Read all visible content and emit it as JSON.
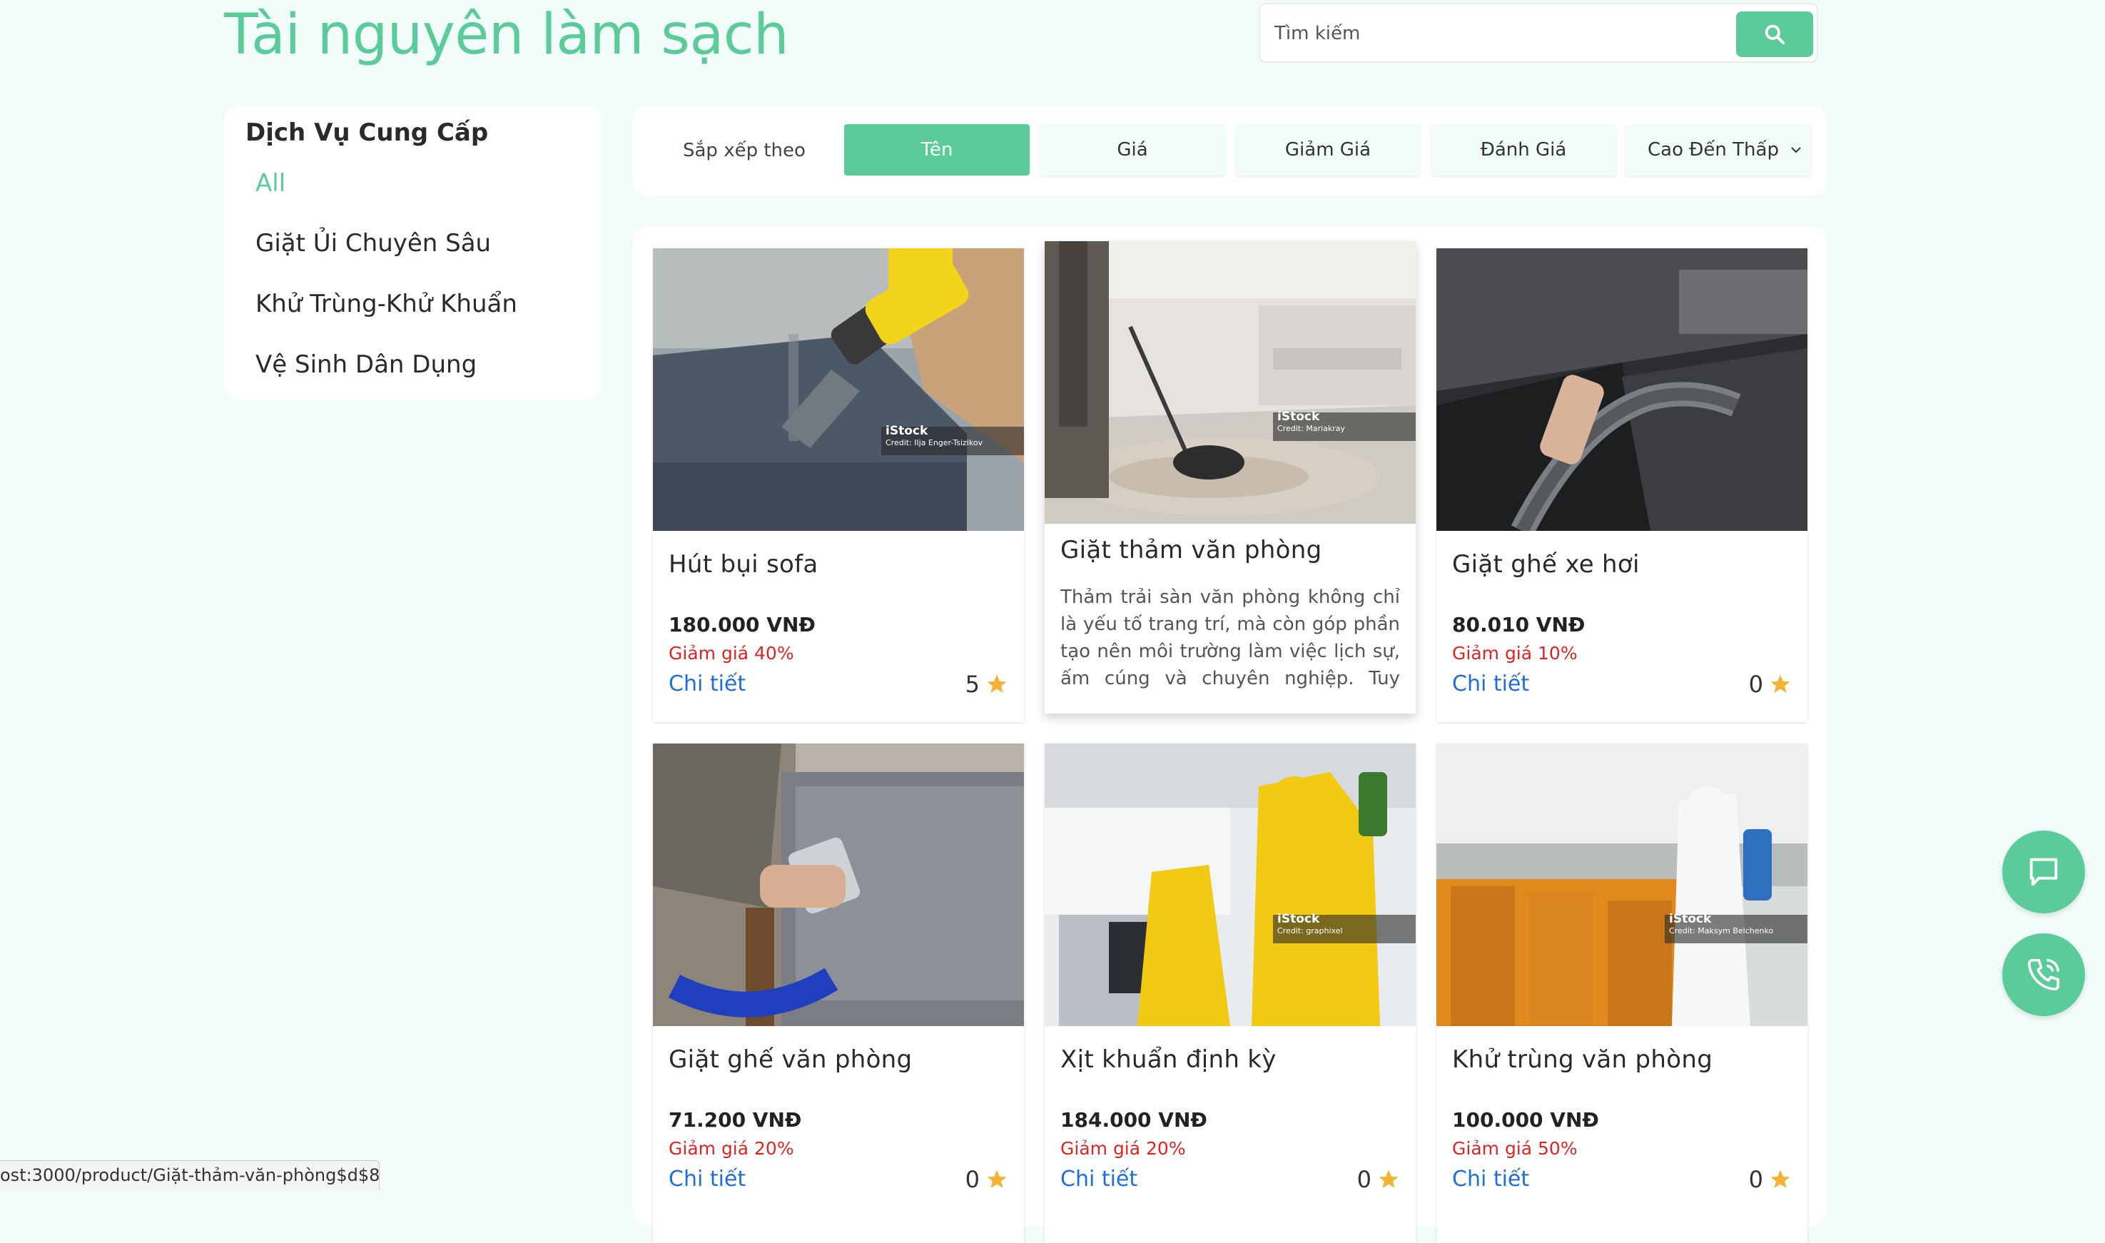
{
  "header": {
    "title": "Tài nguyên làm sạch",
    "search_placeholder": "Tìm kiếm"
  },
  "sidebar": {
    "title": "Dịch Vụ Cung Cấp",
    "items": [
      {
        "label": "All",
        "active": true
      },
      {
        "label": "Giặt Ủi Chuyên Sâu",
        "active": false
      },
      {
        "label": "Khử Trùng-Khử Khuẩn",
        "active": false
      },
      {
        "label": "Vệ Sinh Dân Dụng",
        "active": false
      }
    ]
  },
  "sort": {
    "label": "Sắp xếp theo",
    "buttons": [
      {
        "label": "Tên",
        "active": true
      },
      {
        "label": "Giá",
        "active": false
      },
      {
        "label": "Giảm Giá",
        "active": false
      },
      {
        "label": "Đánh Giá",
        "active": false
      }
    ],
    "order_selected": "Cao Đến Thấp"
  },
  "products": [
    {
      "name": "Hút bụi sofa",
      "price": "180.000 VNĐ",
      "discount": "Giảm giá 40%",
      "link": "Chi tiết",
      "rating": "5",
      "image_caption": "iStock",
      "image_credit": "Credit: Ilja Enger-Tsizikov"
    },
    {
      "name": "Giặt thảm văn phòng",
      "description": "Thảm trải sàn văn phòng không chỉ là yếu tố trang trí, mà còn góp phần tạo nên môi trường làm việc lịch sự, ấm cúng và chuyên nghiệp. Tuy nhiê...",
      "image_caption": "iStock",
      "image_credit": "Credit: Mariakray"
    },
    {
      "name": "Giặt ghế xe hơi",
      "price": "80.010 VNĐ",
      "discount": "Giảm giá 10%",
      "link": "Chi tiết",
      "rating": "0"
    },
    {
      "name": "Giặt ghế văn phòng",
      "price": "71.200 VNĐ",
      "discount": "Giảm giá 20%",
      "link": "Chi tiết",
      "rating": "0"
    },
    {
      "name": "Xịt khuẩn định kỳ",
      "price": "184.000 VNĐ",
      "discount": "Giảm giá 20%",
      "link": "Chi tiết",
      "rating": "0",
      "image_caption": "iStock",
      "image_credit": "Credit: graphixel"
    },
    {
      "name": "Khử trùng văn phòng",
      "price": "100.000 VNĐ",
      "discount": "Giảm giá 50%",
      "link": "Chi tiết",
      "rating": "0",
      "image_caption": "iStock",
      "image_credit": "Credit: Maksym Belchenko"
    }
  ],
  "status_bar": {
    "url": "ost:3000/product/Giặt-thảm-văn-phòng$d$8"
  },
  "colors": {
    "accent": "#5bcb9a",
    "background": "#f1fcfb",
    "discount": "#e02424",
    "link": "#1f6fd6",
    "star": "#f5b335"
  }
}
